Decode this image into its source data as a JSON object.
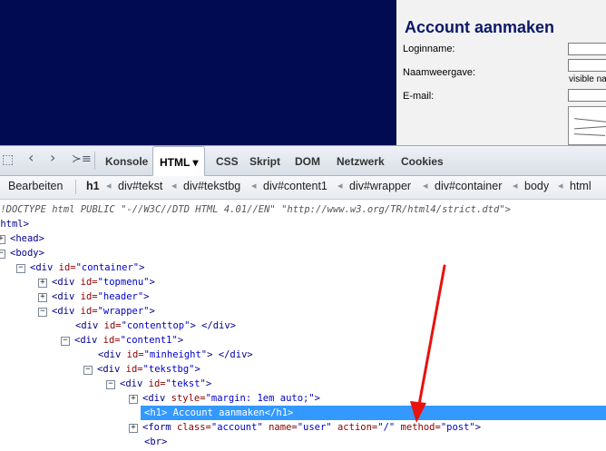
{
  "preview": {
    "title": "Account aanmaken",
    "fields": [
      {
        "label": "Loginname:"
      },
      {
        "label": "Naamweergave:"
      },
      {
        "label": "E-mail:"
      }
    ],
    "hint": "visible na"
  },
  "firebug": {
    "tabs": [
      {
        "label": "Konsole"
      },
      {
        "label": "HTML ▾"
      },
      {
        "label": "CSS"
      },
      {
        "label": "Skript"
      },
      {
        "label": "DOM"
      },
      {
        "label": "Netzwerk"
      },
      {
        "label": "Cookies"
      }
    ],
    "active_tab": "HTML",
    "edit_label": "Bearbeiten",
    "breadcrumbs": [
      "h1",
      "div#tekst",
      "div#tekstbg",
      "div#content1",
      "div#wrapper",
      "div#container",
      "body",
      "html"
    ],
    "doctype": "<!DOCTYPE html PUBLIC \"-//W3C//DTD HTML 4.01//EN\" \"http://www.w3.org/TR/html4/strict.dtd\">",
    "tree": {
      "html": "<html>",
      "head": "<head>",
      "body": "<body>",
      "container": {
        "tag": "<div",
        "attr": "id=",
        "val": "\"container\"",
        "end": ">"
      },
      "topmenu": {
        "tag": "<div",
        "attr": "id=",
        "val": "\"topmenu\"",
        "end": ">"
      },
      "header": {
        "tag": "<div",
        "attr": "id=",
        "val": "\"header\"",
        "end": ">"
      },
      "wrapper": {
        "tag": "<div",
        "attr": "id=",
        "val": "\"wrapper\"",
        "end": ">"
      },
      "contenttop": {
        "tag": "<div",
        "attr": "id=",
        "val": "\"contenttop\"",
        "end": "> </div>"
      },
      "content1": {
        "tag": "<div",
        "attr": "id=",
        "val": "\"content1\"",
        "end": ">"
      },
      "minheight": {
        "tag": "<div",
        "attr": "id=",
        "val": "\"minheight\"",
        "end": "> </div>"
      },
      "tekstbg": {
        "tag": "<div",
        "attr": "id=",
        "val": "\"tekstbg\"",
        "end": ">"
      },
      "tekst": {
        "tag": "<div",
        "attr": "id=",
        "val": "\"tekst\"",
        "end": ">"
      },
      "styled": {
        "tag": "<div",
        "attr": "style=",
        "val": "\"margin: 1em auto;\"",
        "end": ">"
      },
      "h1": "<h1> Account aanmaken</h1>",
      "form": {
        "tag": "<form",
        "a1": "class=",
        "v1": "\"account\"",
        "a2": "name=",
        "v2": "\"user\"",
        "a3": "action=",
        "v3": "\"/\"",
        "a4": "method=",
        "v4": "\"post\"",
        "end": ">"
      },
      "br": "<br>"
    },
    "colors": {
      "selection": "#3399ff",
      "annotation_arrow": "#e8120f"
    }
  }
}
